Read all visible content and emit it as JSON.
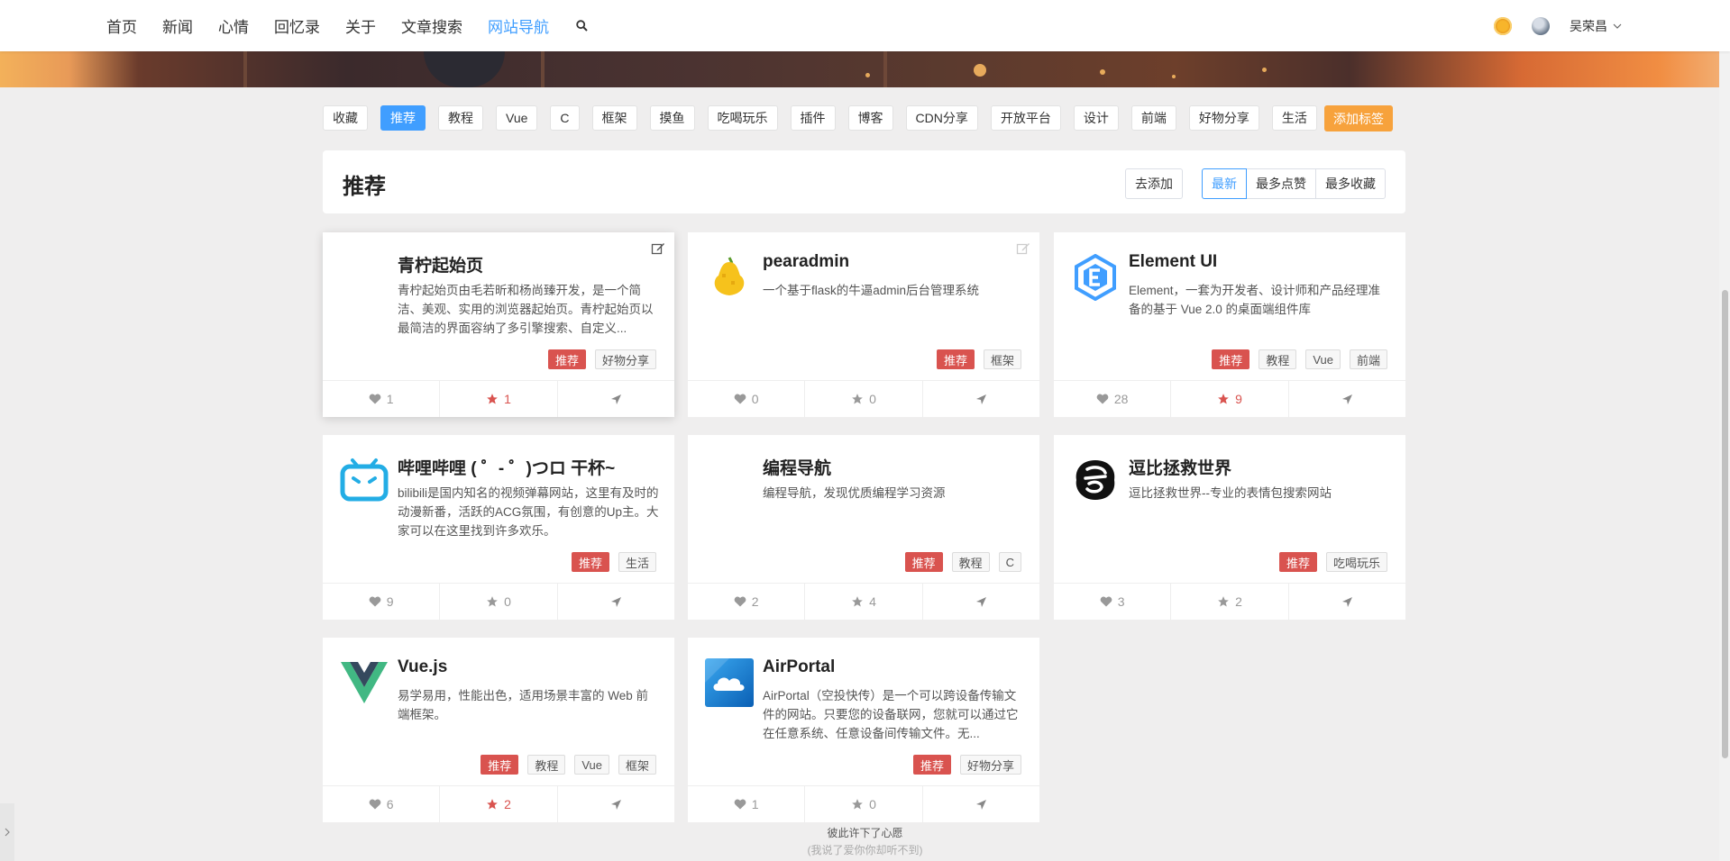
{
  "nav": {
    "links": [
      "首页",
      "新闻",
      "心情",
      "回忆录",
      "关于",
      "文章搜索",
      "网站导航"
    ],
    "active": "网站导航",
    "username": "吴荣昌"
  },
  "tags": [
    "收藏",
    "推荐",
    "教程",
    "Vue",
    "C",
    "框架",
    "摸鱼",
    "吃喝玩乐",
    "插件",
    "博客",
    "CDN分享",
    "开放平台",
    "设计",
    "前端",
    "好物分享",
    "生活"
  ],
  "active_tag": "推荐",
  "add_tag_label": "添加标签",
  "panel": {
    "title": "推荐",
    "add_button": "去添加",
    "sort": [
      "最新",
      "最多点赞",
      "最多收藏"
    ]
  },
  "cards": [
    {
      "name": "青柠起始页",
      "desc": "青柠起始页由毛若昕和杨尚臻开发，是一个简洁、美观、实用的浏览器起始页。青柠起始页以最简洁的界面容纳了多引擎搜索、自定义...",
      "tags": [
        "推荐",
        "好物分享"
      ],
      "likes": "1",
      "stars": "1",
      "icon": "blank-logo"
    },
    {
      "name": "pearadmin",
      "desc": "一个基于flask的牛逼admin后台管理系统",
      "tags": [
        "推荐",
        "框架"
      ],
      "likes": "0",
      "stars": "0",
      "icon": "pear-logo"
    },
    {
      "name": "Element UI",
      "desc": "Element，一套为开发者、设计师和产品经理准备的基于 Vue 2.0 的桌面端组件库",
      "tags": [
        "推荐",
        "教程",
        "Vue",
        "前端"
      ],
      "likes": "28",
      "stars": "9",
      "icon": "element-logo"
    },
    {
      "name": "哔哩哔哩 ( ゜- ゜)つロ 干杯~",
      "desc": "bilibili是国内知名的视频弹幕网站，这里有及时的动漫新番，活跃的ACG氛围，有创意的Up主。大家可以在这里找到许多欢乐。",
      "tags": [
        "推荐",
        "生活"
      ],
      "likes": "9",
      "stars": "0",
      "icon": "bilibili-logo"
    },
    {
      "name": "编程导航",
      "desc": "编程导航，发现优质编程学习资源",
      "tags": [
        "推荐",
        "教程",
        "C"
      ],
      "likes": "2",
      "stars": "4",
      "icon": "blank-logo"
    },
    {
      "name": "逗比拯救世界",
      "desc": "逗比拯救世界--专业的表情包搜索网站",
      "tags": [
        "推荐",
        "吃喝玩乐"
      ],
      "likes": "3",
      "stars": "2",
      "icon": "doubi-logo"
    },
    {
      "name": "Vue.js",
      "desc": "易学易用，性能出色，适用场景丰富的 Web 前端框架。",
      "tags": [
        "推荐",
        "教程",
        "Vue",
        "框架"
      ],
      "likes": "6",
      "stars": "2",
      "icon": "vue-logo"
    },
    {
      "name": "AirPortal",
      "desc": "AirPortal（空投快传）是一个可以跨设备传输文件的网站。只要您的设备联网，您就可以通过它在任意系统、任意设备间传输文件。无...",
      "tags": [
        "推荐",
        "好物分享"
      ],
      "likes": "1",
      "stars": "0",
      "icon": "airportal-logo"
    }
  ],
  "footer": {
    "line1": "彼此许下了心愿",
    "line2": "(我说了爱你你却听不到)"
  },
  "colors": {
    "accent": "#409eff",
    "red": "#d9534f",
    "orange": "#f7a23c"
  }
}
